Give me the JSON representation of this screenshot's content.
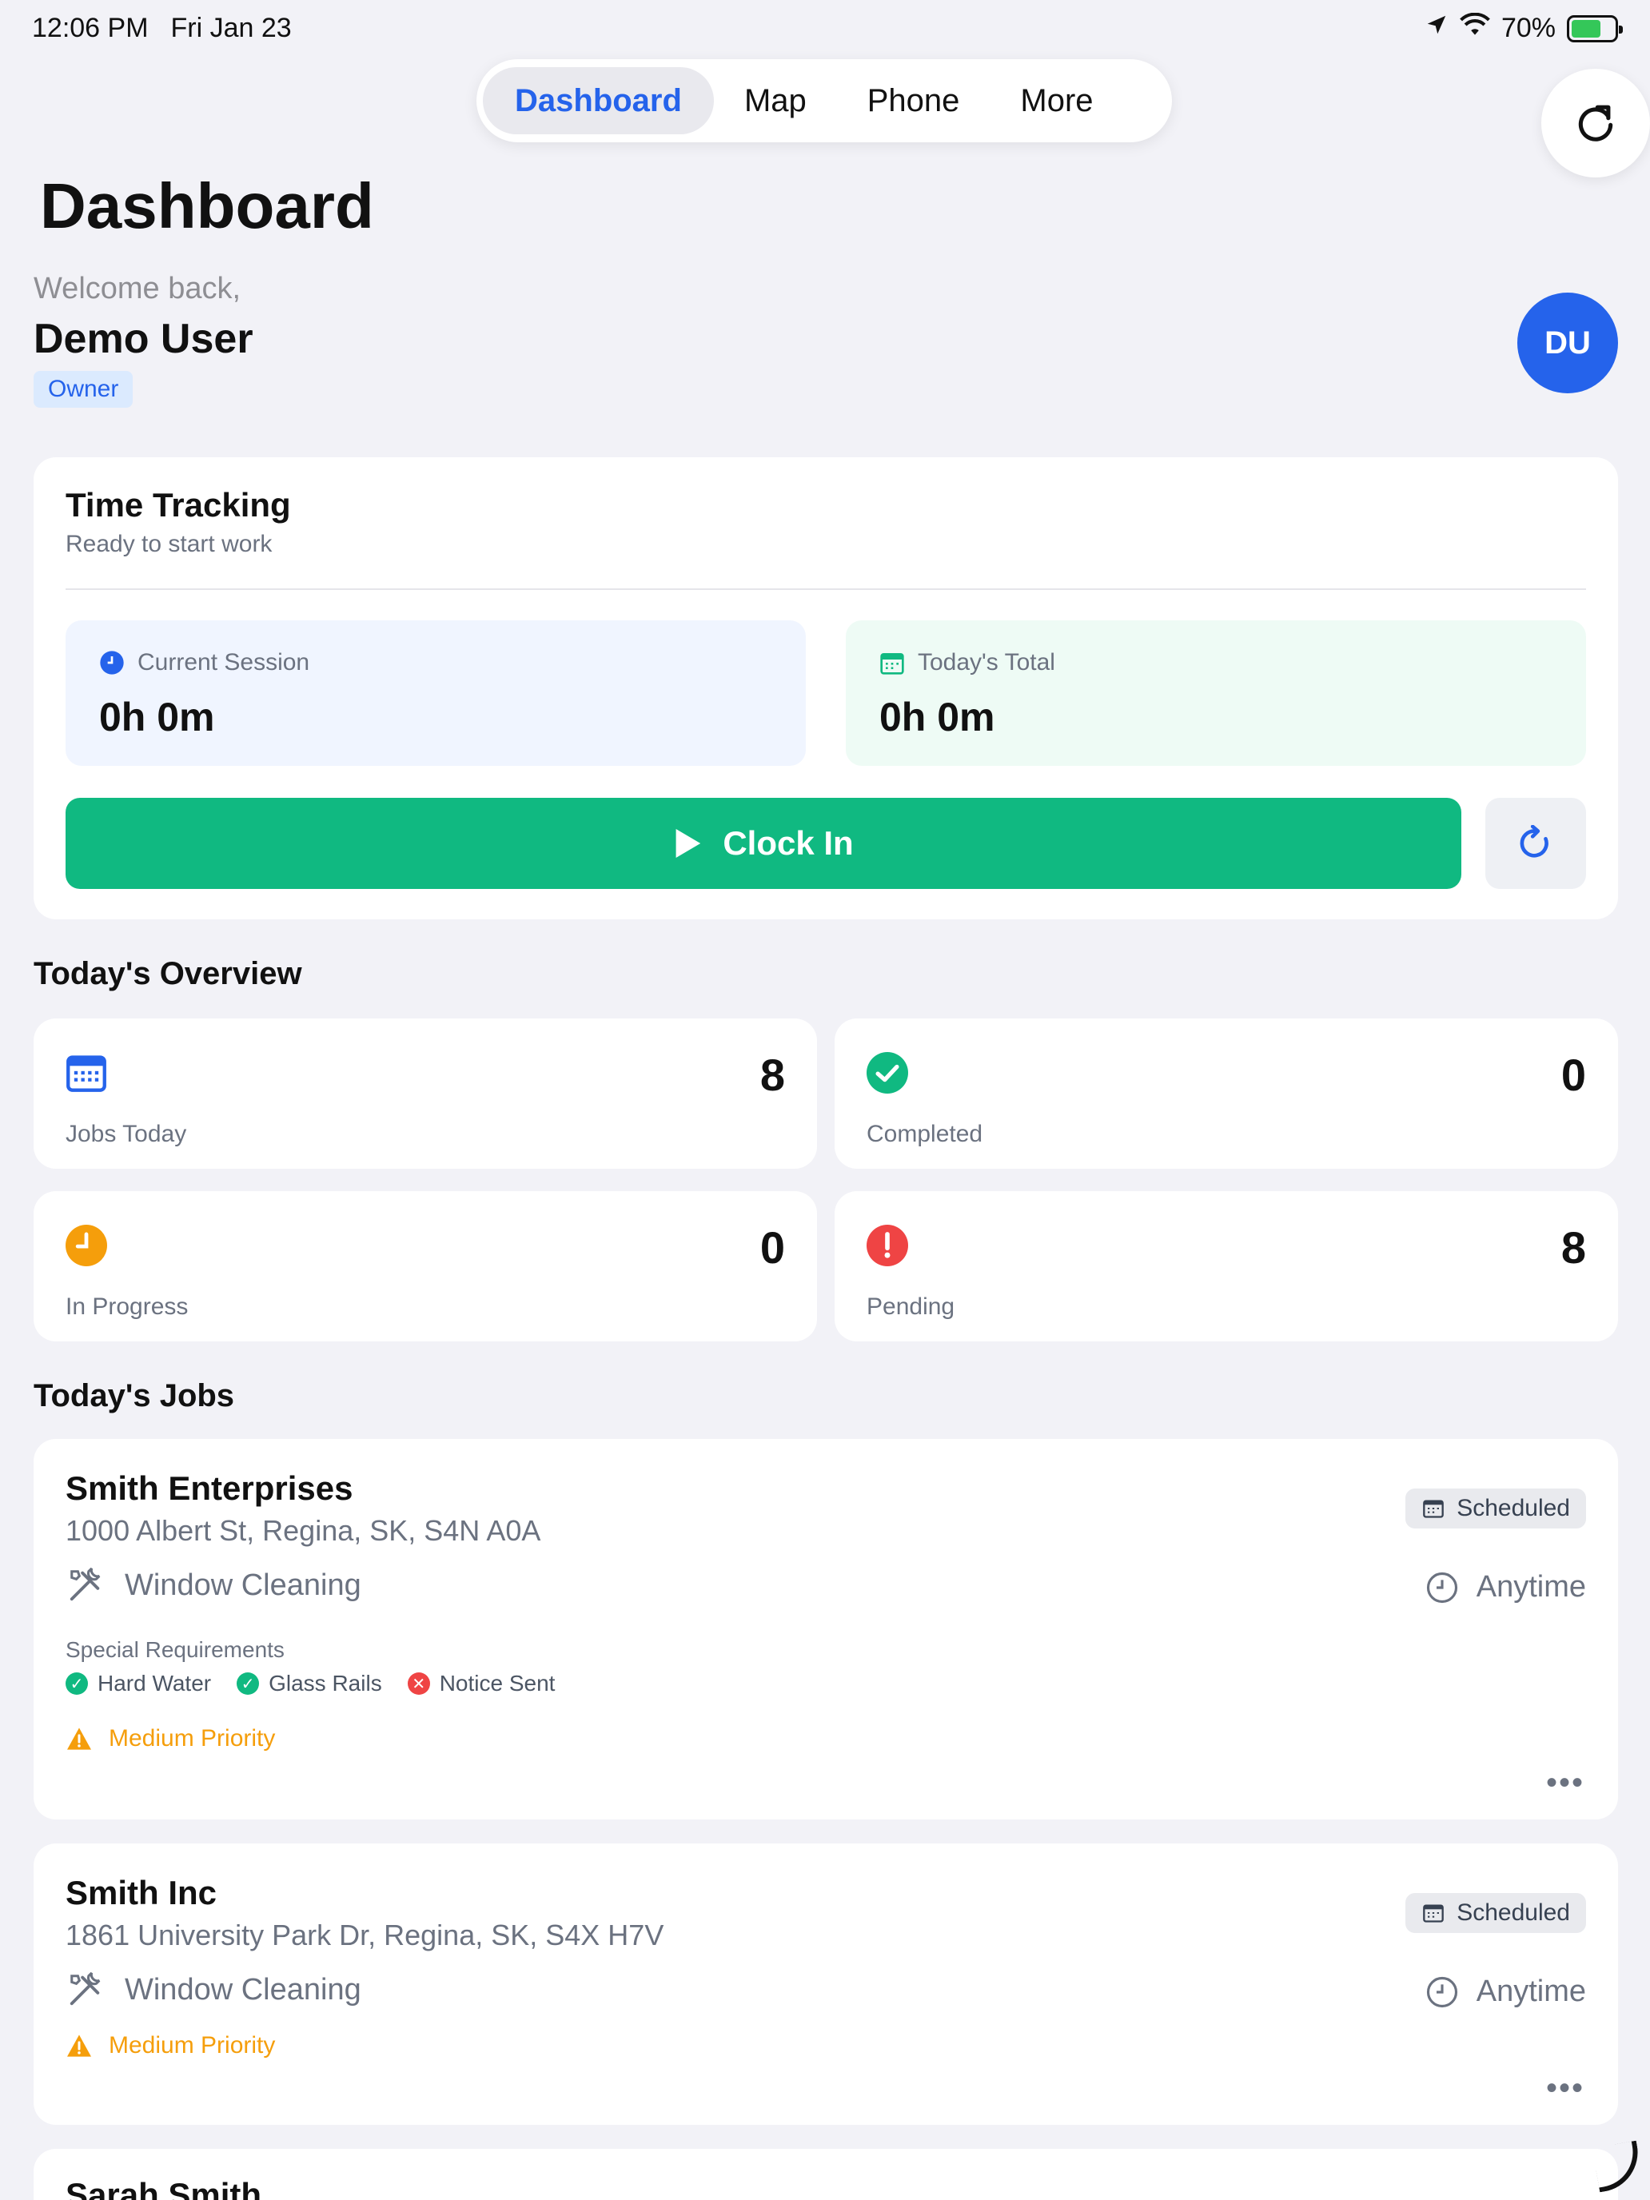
{
  "status_bar": {
    "time": "12:06 PM",
    "date": "Fri Jan 23",
    "battery": "70%",
    "battery_level": 0.7
  },
  "nav": {
    "tabs": [
      {
        "label": "Dashboard",
        "active": true
      },
      {
        "label": "Map",
        "active": false
      },
      {
        "label": "Phone",
        "active": false
      },
      {
        "label": "More",
        "active": false
      }
    ]
  },
  "page": {
    "title": "Dashboard"
  },
  "user": {
    "welcome": "Welcome back,",
    "name": "Demo User",
    "role": "Owner",
    "initials": "DU"
  },
  "time_tracking": {
    "title": "Time Tracking",
    "subtitle": "Ready to start work",
    "current_session_label": "Current Session",
    "current_session_value": "0h 0m",
    "today_total_label": "Today's Total",
    "today_total_value": "0h 0m",
    "clock_in_label": "Clock In"
  },
  "overview": {
    "heading": "Today's Overview",
    "stats": [
      {
        "label": "Jobs Today",
        "value": "8",
        "icon": "calendar-icon",
        "color": "#2563eb"
      },
      {
        "label": "Completed",
        "value": "0",
        "icon": "check-circle-icon",
        "color": "#10b981"
      },
      {
        "label": "In Progress",
        "value": "0",
        "icon": "clock-icon",
        "color": "#f59e0b"
      },
      {
        "label": "Pending",
        "value": "8",
        "icon": "alert-circle-icon",
        "color": "#ef4444"
      }
    ]
  },
  "jobs": {
    "heading": "Today's Jobs",
    "list": [
      {
        "name": "Smith Enterprises",
        "address": "1000 Albert St, Regina, SK, S4N A0A",
        "service": "Window Cleaning",
        "status": "Scheduled",
        "time": "Anytime",
        "requirements_title": "Special Requirements",
        "requirements": [
          {
            "label": "Hard Water",
            "ok": true
          },
          {
            "label": "Glass Rails",
            "ok": true
          },
          {
            "label": "Notice Sent",
            "ok": false
          }
        ],
        "priority": "Medium Priority"
      },
      {
        "name": "Smith Inc",
        "address": "1861 University Park Dr, Regina, SK, S4X H7V",
        "service": "Window Cleaning",
        "status": "Scheduled",
        "time": "Anytime",
        "priority": "Medium Priority"
      },
      {
        "name": "Sarah Smith"
      }
    ]
  },
  "colors": {
    "accent": "#2563eb",
    "success": "#10b981",
    "warning": "#f59e0b",
    "danger": "#ef4444",
    "background": "#f2f2f7"
  }
}
